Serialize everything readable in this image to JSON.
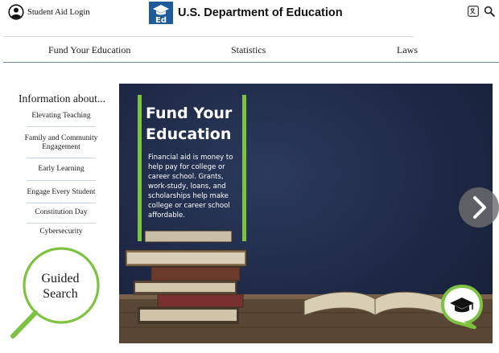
{
  "header": {
    "login_label": "Student Aid Login",
    "brand_title": "U.S. Department of Education",
    "tools": [
      {
        "name": "translate-icon"
      },
      {
        "name": "search-icon"
      }
    ]
  },
  "nav": {
    "items": [
      {
        "label": "Fund Your Education"
      },
      {
        "label": "Statistics"
      },
      {
        "label": "Laws"
      }
    ]
  },
  "sidebar": {
    "heading": "Information about...",
    "items": [
      {
        "label": "Elevating Teaching"
      },
      {
        "label": "Family and Community Engagement"
      },
      {
        "label": "Early Learning"
      },
      {
        "label": "Engage Every Student"
      },
      {
        "label": "Constitution Day"
      },
      {
        "label": "Cybersecurity"
      }
    ],
    "guided_search": "Guided Search"
  },
  "hero": {
    "title": "Fund Your Education",
    "body": "Financial aid is money to help pay for college or career school. Grants, work-study, loans, and scholarships help make college or career school affordable."
  },
  "colors": {
    "accent_green": "#7ec242",
    "nav_rule": "#6f8a9e",
    "logo_blue": "#1f5b9a"
  }
}
